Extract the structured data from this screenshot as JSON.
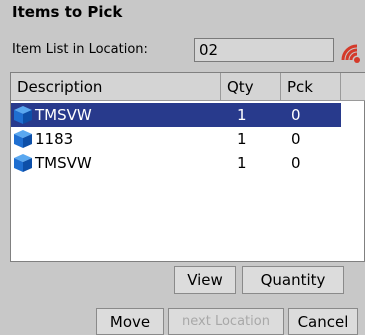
{
  "screen": {
    "title": "Items to Pick",
    "location_label": "Item List in Location:",
    "location_value": "02",
    "signal_icon": "wireless-signal-icon"
  },
  "grid": {
    "columns": [
      "Description",
      "Qty",
      "Pck"
    ],
    "rows": [
      {
        "description": "TMSVW",
        "qty": "1",
        "pck": "0",
        "selected": true,
        "icon": "blue-box-icon"
      },
      {
        "description": "1183",
        "qty": "1",
        "pck": "0",
        "selected": false,
        "icon": "blue-box-icon"
      },
      {
        "description": "TMSVW",
        "qty": "1",
        "pck": "0",
        "selected": false,
        "icon": "blue-box-icon"
      }
    ]
  },
  "buttons": {
    "view": "View",
    "quantity": "Quantity",
    "move": "Move",
    "next_location": "next Location",
    "cancel": "Cancel"
  },
  "colors": {
    "selection": "#283a8c",
    "background": "#c8c8c8",
    "disabled_text": "#a8a8a8"
  }
}
